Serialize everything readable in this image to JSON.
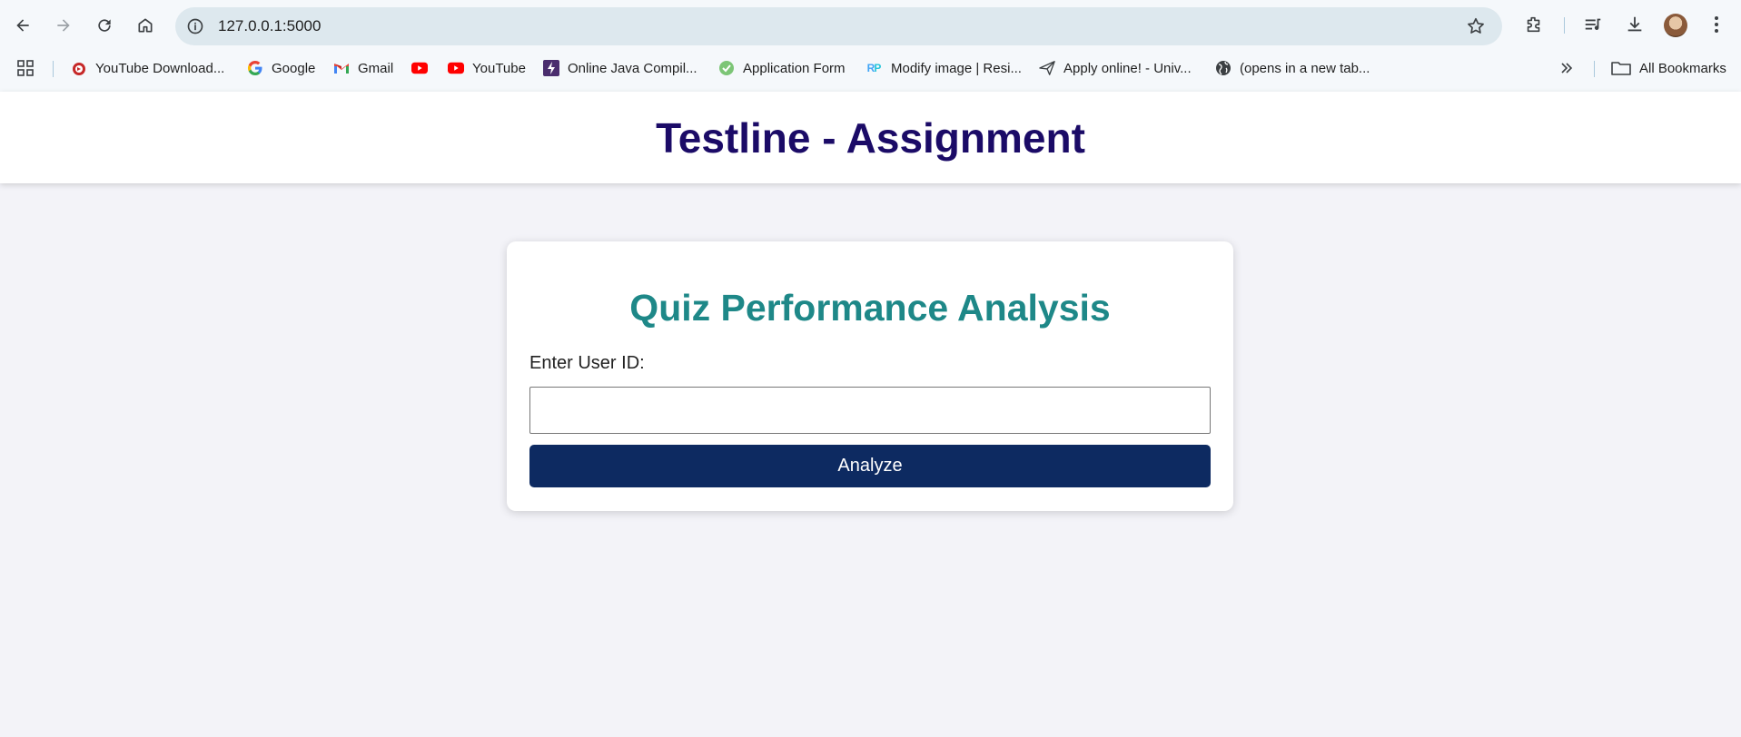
{
  "browser": {
    "url": "127.0.0.1:5000",
    "bookmarks": [
      {
        "label": "YouTube Download...",
        "icon": "youtube-downloader-icon"
      },
      {
        "label": "Google",
        "icon": "google-icon"
      },
      {
        "label": "Gmail",
        "icon": "gmail-icon"
      },
      {
        "label": "",
        "icon": "youtube-icon"
      },
      {
        "label": "YouTube",
        "icon": "youtube-icon"
      },
      {
        "label": "Online Java Compil...",
        "icon": "online-compiler-icon"
      },
      {
        "label": "Application Form",
        "icon": "form-check-icon"
      },
      {
        "label": "Modify image | Resi...",
        "icon": "rp-icon"
      },
      {
        "label": "Apply online! - Univ...",
        "icon": "paper-plane-icon"
      },
      {
        "label": "(opens in a new tab...",
        "icon": "globe-icon"
      }
    ],
    "all_bookmarks_label": "All Bookmarks"
  },
  "page": {
    "header_title": "Testline - Assignment",
    "card_title": "Quiz Performance Analysis",
    "user_id_label": "Enter User ID:",
    "user_id_value": "",
    "analyze_label": "Analyze"
  },
  "colors": {
    "header_title": "#1b0b67",
    "card_title": "#1e8888",
    "button": "#0d2a61",
    "page_bg": "#f3f3f8"
  }
}
